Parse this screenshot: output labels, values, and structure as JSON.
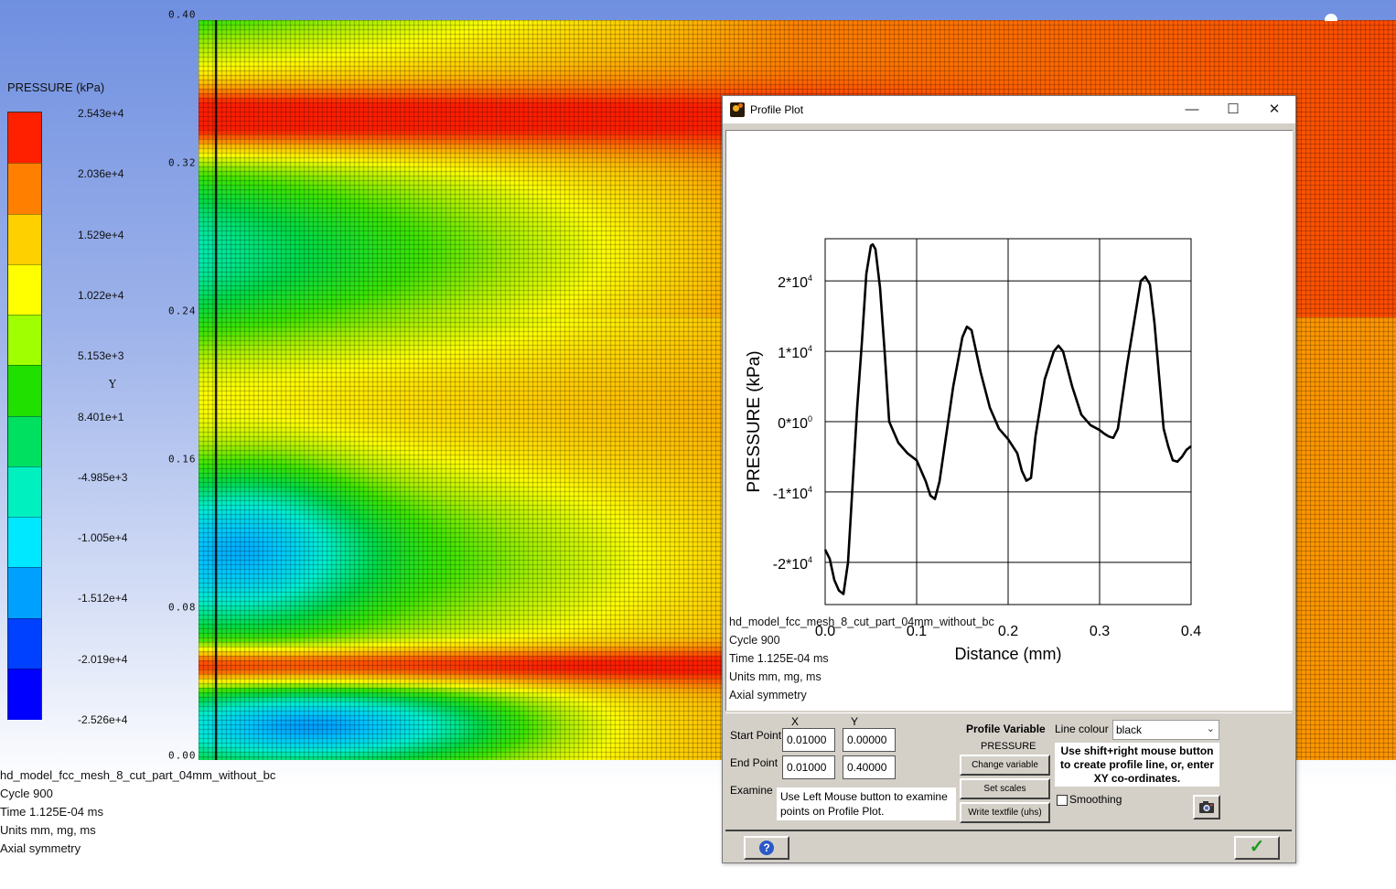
{
  "legend": {
    "title": "PRESSURE (kPa)",
    "labels": [
      "2.543e+4",
      "2.036e+4",
      "1.529e+4",
      "1.022e+4",
      "5.153e+3",
      "8.401e+1",
      "-4.985e+3",
      "-1.005e+4",
      "-1.512e+4",
      "-2.019e+4",
      "-2.526e+4"
    ],
    "colors": [
      "#ff2000",
      "#ff8000",
      "#ffd000",
      "#ffff00",
      "#a0ff00",
      "#20e000",
      "#00e060",
      "#00f0c0",
      "#00e8ff",
      "#00a0ff",
      "#0040ff",
      "#0000ff"
    ],
    "axis_letter": "Y"
  },
  "mesh": {
    "y_ticks": [
      "0.40",
      "0.32",
      "0.24",
      "0.16",
      "0.08",
      "0.00"
    ]
  },
  "info": {
    "model": "hd_model_fcc_mesh_8_cut_part_04mm_without_bc",
    "cycle": "Cycle 900",
    "time": "Time 1.125E-04 ms",
    "units": "Units mm, mg, ms",
    "symmetry": "Axial symmetry"
  },
  "dialog": {
    "title": "Profile Plot",
    "minimize": "—",
    "maximize": "☐",
    "close": "✕",
    "controls": {
      "x_header": "X",
      "y_header": "Y",
      "start_label": "Start Point",
      "end_label": "End Point",
      "start_x": "0.01000",
      "start_y": "0.00000",
      "end_x": "0.01000",
      "end_y": "0.40000",
      "examine_label": "Examine",
      "examine_text": "Use Left Mouse button to examine points on Profile Plot.",
      "profile_variable_label": "Profile Variable",
      "profile_variable_value": "PRESSURE",
      "change_variable": "Change variable",
      "set_scales": "Set scales",
      "write_textfile": "Write textfile (uhs)",
      "line_colour_label": "Line colour",
      "line_colour_value": "black",
      "hint": "Use shift+right mouse button to create profile line, or, enter XY co-ordinates.",
      "smoothing": "Smoothing",
      "help": "?",
      "ok": "✓"
    }
  },
  "chart_data": {
    "type": "line",
    "xlabel": "Distance (mm)",
    "ylabel": "PRESSURE  (kPa)",
    "xlim": [
      0,
      0.4
    ],
    "ylim": [
      -26000,
      26000
    ],
    "x_ticks": [
      "0.0",
      "0.1",
      "0.2",
      "0.3",
      "0.4"
    ],
    "y_ticks": [
      {
        "value": 20000,
        "base": "2*10",
        "exp": "4"
      },
      {
        "value": 10000,
        "base": "1*10",
        "exp": "4"
      },
      {
        "value": 0,
        "base": "0*10",
        "exp": "0"
      },
      {
        "value": -10000,
        "base": "-1*10",
        "exp": "4"
      },
      {
        "value": -20000,
        "base": "-2*10",
        "exp": "4"
      }
    ],
    "grid": true,
    "series": [
      {
        "color": "black",
        "x": [
          0.0,
          0.005,
          0.01,
          0.015,
          0.02,
          0.025,
          0.03,
          0.035,
          0.04,
          0.045,
          0.05,
          0.052,
          0.055,
          0.06,
          0.065,
          0.07,
          0.08,
          0.09,
          0.1,
          0.11,
          0.115,
          0.12,
          0.125,
          0.13,
          0.14,
          0.15,
          0.155,
          0.16,
          0.17,
          0.18,
          0.19,
          0.2,
          0.21,
          0.215,
          0.22,
          0.225,
          0.23,
          0.24,
          0.25,
          0.255,
          0.26,
          0.27,
          0.28,
          0.29,
          0.3,
          0.305,
          0.31,
          0.315,
          0.32,
          0.33,
          0.34,
          0.345,
          0.35,
          0.355,
          0.36,
          0.37,
          0.375,
          0.38,
          0.385,
          0.39,
          0.395,
          0.4
        ],
        "y": [
          -18200,
          -19500,
          -22500,
          -24000,
          -24500,
          -20000,
          -9000,
          2000,
          11000,
          21000,
          25000,
          25200,
          24500,
          19000,
          10000,
          0,
          -3000,
          -4500,
          -5500,
          -8500,
          -10500,
          -11000,
          -8500,
          -4000,
          5000,
          12000,
          13500,
          13000,
          7000,
          2000,
          -1000,
          -2500,
          -4500,
          -7000,
          -8400,
          -8000,
          -2000,
          6000,
          10000,
          10800,
          10000,
          5000,
          1000,
          -500,
          -1200,
          -1700,
          -2100,
          -2300,
          -1000,
          8000,
          16000,
          20000,
          20600,
          19500,
          14000,
          -1000,
          -3500,
          -5500,
          -5700,
          -5000,
          -4000,
          -3500
        ]
      }
    ]
  }
}
